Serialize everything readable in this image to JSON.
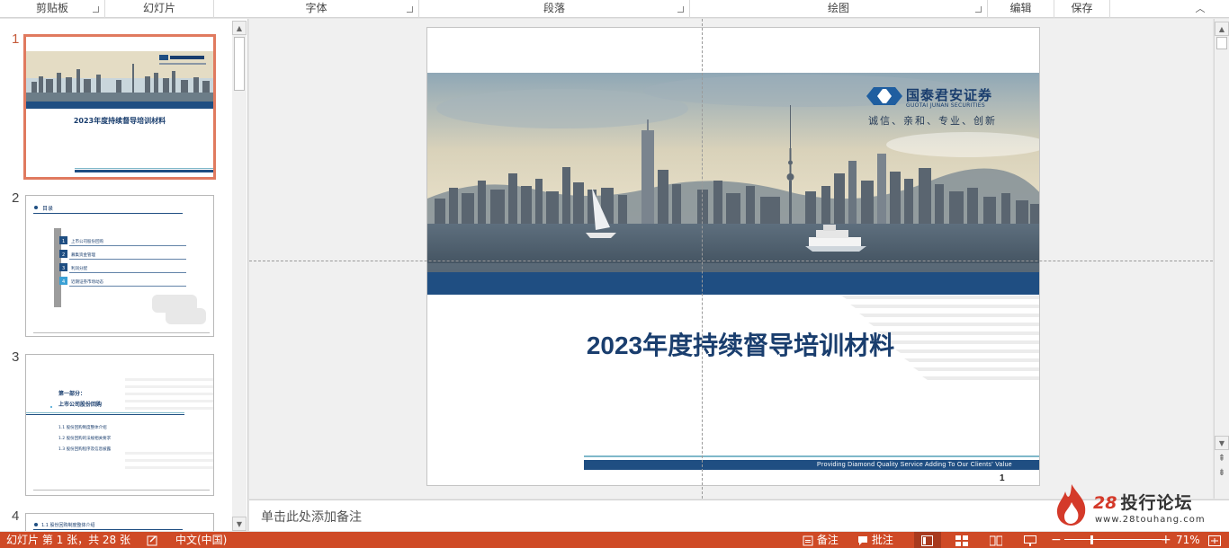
{
  "ribbon": {
    "groups": [
      "剪贴板",
      "幻灯片",
      "字体",
      "段落",
      "绘图",
      "编辑",
      "保存"
    ]
  },
  "thumbnails": [
    {
      "number": "1",
      "title": "2023年度持续督导培训材料"
    },
    {
      "number": "2",
      "heading": "目录",
      "items": [
        "上市公司股份回购",
        "募集资金管理",
        "利润分配",
        "近期证券市场动态"
      ]
    },
    {
      "number": "3",
      "part": "第一部分：",
      "part_title": "上市公司股份回购",
      "items": [
        "1.1 股份回购制度整体介绍",
        "1.2 股份回购的法规相关要求",
        "1.3 股份回购程序及信息披露"
      ]
    },
    {
      "number": "4",
      "heading": "1.1 股份回购制度整体介绍"
    }
  ],
  "slide": {
    "logo_cn": "国泰君安证券",
    "logo_en": "GUOTAI JUNAN SECURITIES",
    "slogan": "诚信、亲和、专业、创新",
    "title": "2023年度持续督导培训材料",
    "footer": "Providing Diamond Quality Service    Adding To Our Clients' Value",
    "page_number": "1"
  },
  "notes_placeholder": "单击此处添加备注",
  "watermark": {
    "number": "28",
    "name": "投行论坛",
    "url": "www.28touhang.com"
  },
  "status": {
    "slide_info": "幻灯片 第 1 张，共 28 张",
    "language": "中文(中国)",
    "notes_btn": "备注",
    "comments_btn": "批注",
    "zoom": "71%"
  },
  "colors": {
    "status_bar": "#cf4a26",
    "navy": "#1f4e82",
    "selected_thumb_border": "#e07a5f"
  }
}
